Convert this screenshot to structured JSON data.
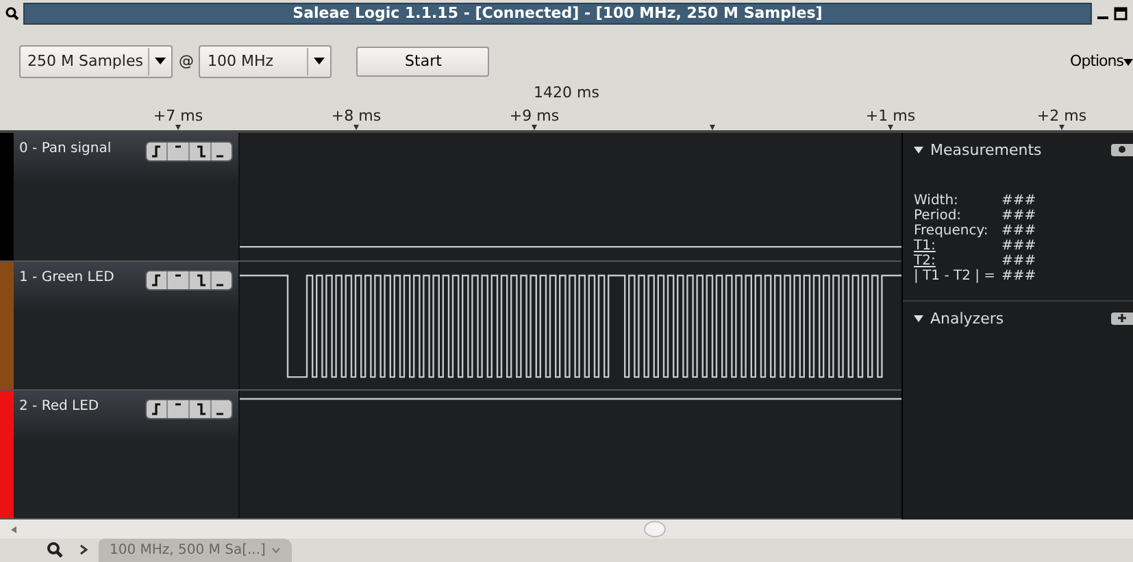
{
  "window": {
    "title": "Saleae Logic 1.1.15 - [Connected] - [100 MHz, 250 M Samples]"
  },
  "toolbar": {
    "samples": "250 M Samples",
    "at": "@",
    "rate": "100 MHz",
    "start": "Start",
    "options": "Options"
  },
  "ruler": {
    "center": "1420 ms",
    "ticks": [
      {
        "kind": "labeled",
        "label": "+7 ms"
      },
      {
        "kind": "labeled",
        "label": "+8 ms"
      },
      {
        "kind": "labeled",
        "label": "+9 ms"
      },
      {
        "kind": "marker"
      },
      {
        "kind": "labeled",
        "label": "+1 ms"
      },
      {
        "kind": "labeled",
        "label": "+2 ms"
      }
    ]
  },
  "channels": [
    {
      "name": "0 - Pan signal",
      "color": "#000000",
      "kind": "low"
    },
    {
      "name": "1 - Green LED",
      "color": "#8a4a14",
      "kind": "pulses"
    },
    {
      "name": "2 - Red LED",
      "color": "#ee1111",
      "kind": "high"
    }
  ],
  "measurements": {
    "title": "Measurements",
    "rows": [
      {
        "label": "Width:",
        "value": "###",
        "underlined": false
      },
      {
        "label": "Period:",
        "value": "###",
        "underlined": false
      },
      {
        "label": "Frequency:",
        "value": "###",
        "underlined": false
      },
      {
        "label": "T1:",
        "value": "###",
        "underlined": true
      },
      {
        "label": "T2:",
        "value": "###",
        "underlined": true
      },
      {
        "label": "| T1 - T2 | =",
        "value": "###",
        "underlined": false
      }
    ]
  },
  "analyzers": {
    "title": "Analyzers"
  },
  "tabs": [
    {
      "label": "100 MHz, 500 M Sa[...]",
      "selected": false
    }
  ]
}
